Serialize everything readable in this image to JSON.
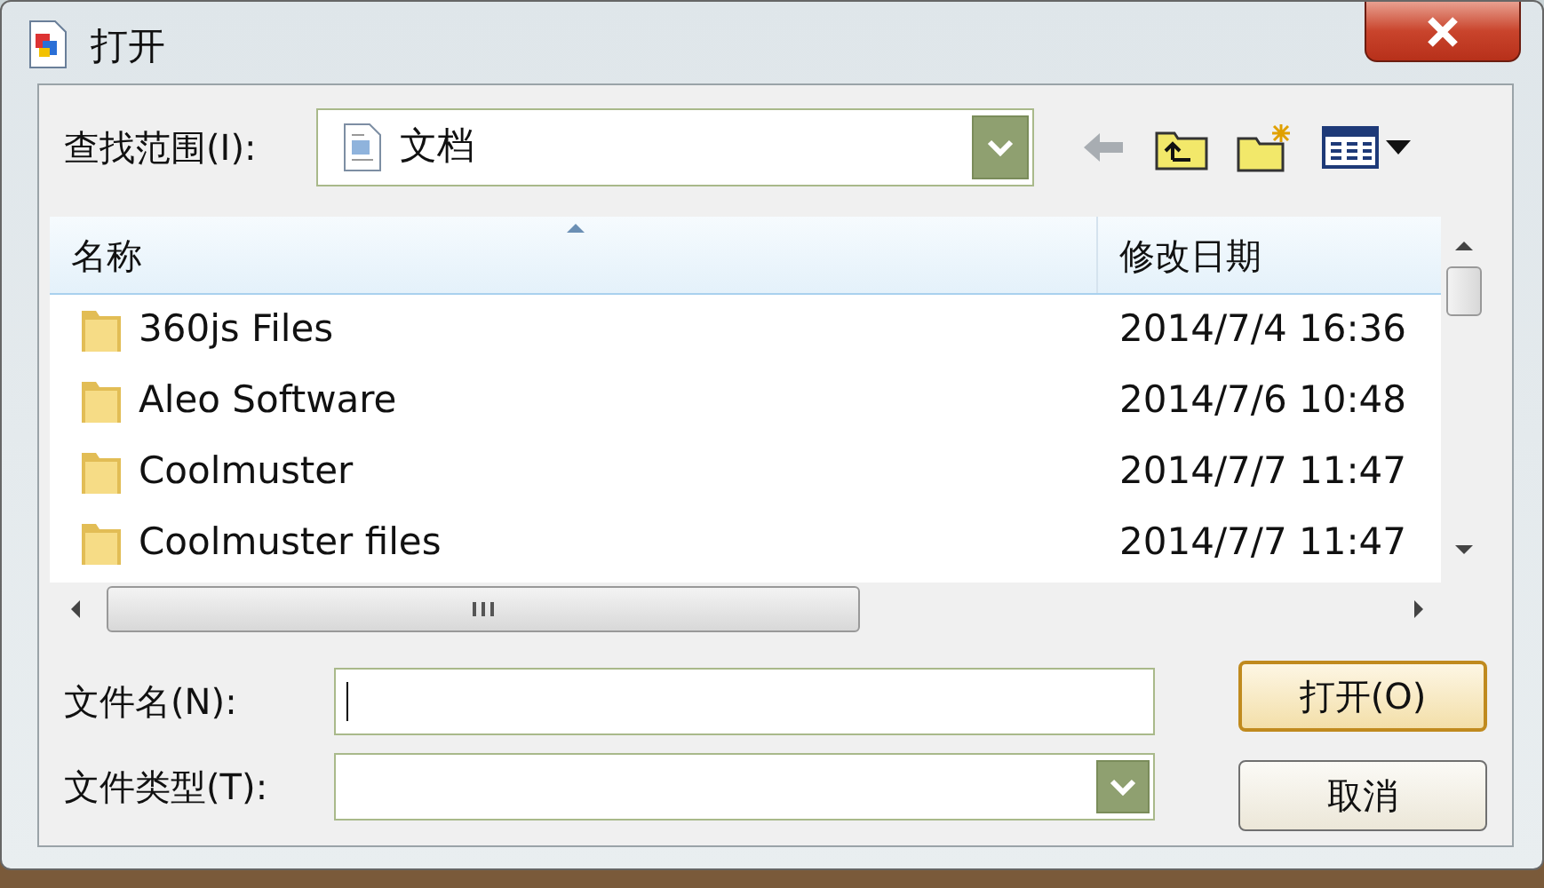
{
  "window": {
    "title": "打开"
  },
  "look_in": {
    "label": "查找范围(I):",
    "value": "文档"
  },
  "columns": [
    {
      "label": "名称",
      "sorted": true
    },
    {
      "label": "修改日期",
      "sorted": false
    }
  ],
  "rows": [
    {
      "name": "360js Files",
      "date": "2014/7/4 16:36"
    },
    {
      "name": "Aleo Software",
      "date": "2014/7/6 10:48"
    },
    {
      "name": "Coolmuster",
      "date": "2014/7/7 11:47"
    },
    {
      "name": "Coolmuster files",
      "date": "2014/7/7 11:47"
    }
  ],
  "file_name": {
    "label": "文件名(N):"
  },
  "file_type": {
    "label": "文件类型(T):"
  },
  "buttons": [
    {
      "label": "打开(O)",
      "default": true
    },
    {
      "label": "取消",
      "default": false
    }
  ]
}
